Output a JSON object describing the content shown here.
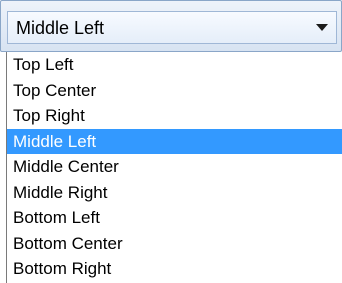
{
  "dropdown": {
    "selected_value": "Middle Left",
    "arrow_icon": "triangle-down-icon"
  },
  "options": [
    {
      "label": "Top Left",
      "selected": false
    },
    {
      "label": "Top Center",
      "selected": false
    },
    {
      "label": "Top Right",
      "selected": false
    },
    {
      "label": "Middle Left",
      "selected": true
    },
    {
      "label": "Middle Center",
      "selected": false
    },
    {
      "label": "Middle Right",
      "selected": false
    },
    {
      "label": "Bottom Left",
      "selected": false
    },
    {
      "label": "Bottom Center",
      "selected": false
    },
    {
      "label": "Bottom Right",
      "selected": false
    }
  ],
  "colors": {
    "selection_background": "#3399ff",
    "selection_text": "#ffffff"
  }
}
